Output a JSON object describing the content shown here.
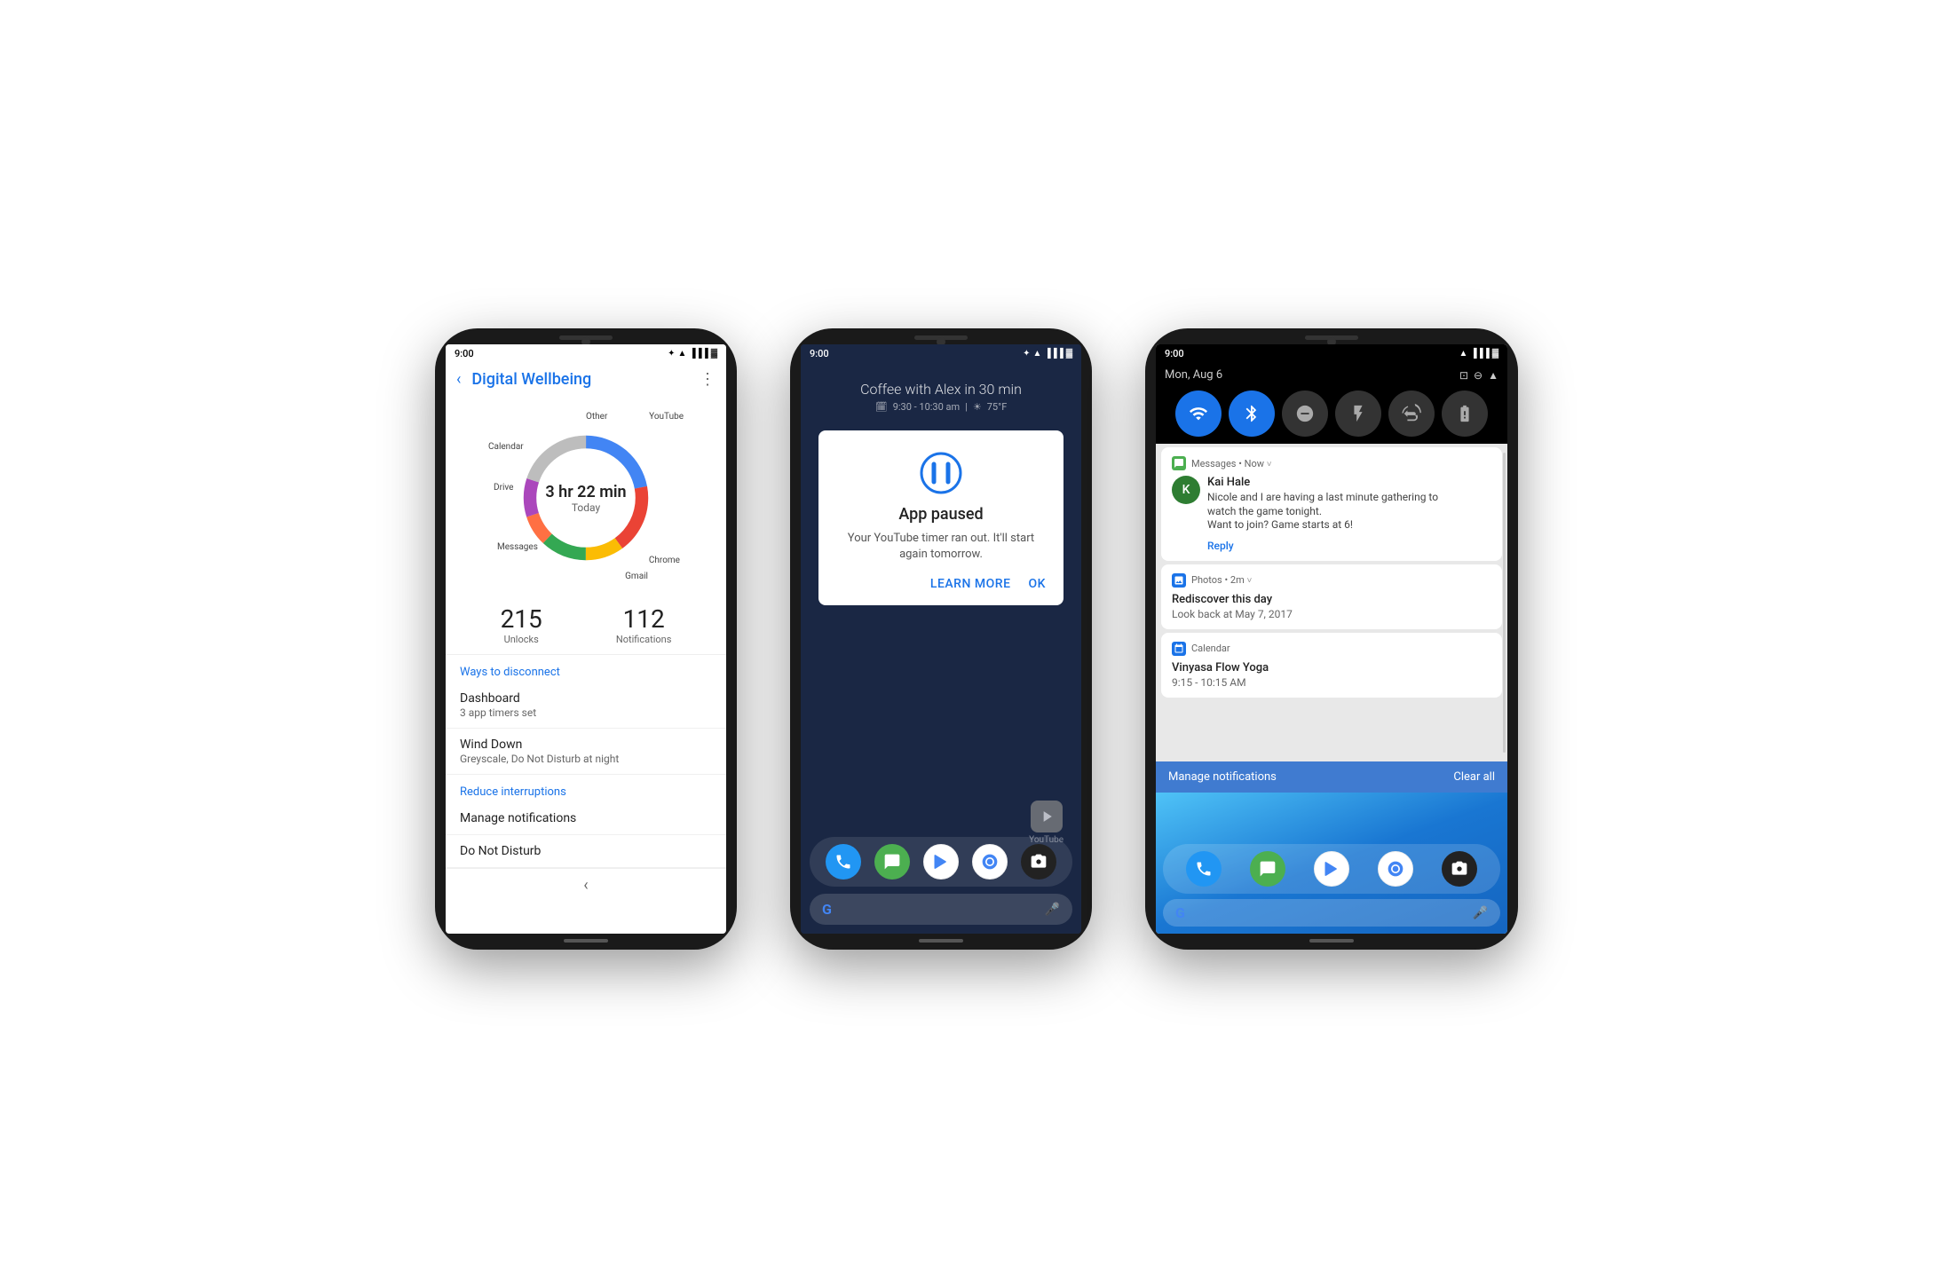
{
  "phone1": {
    "status": {
      "time": "9:00",
      "icons": [
        "bluetooth",
        "wifi",
        "signal",
        "battery"
      ]
    },
    "header": {
      "back_label": "‹",
      "title": "Digital Wellbeing",
      "menu_label": "⋮"
    },
    "donut": {
      "time_label": "3 hr 22 min",
      "today_label": "Today",
      "segments": [
        {
          "label": "YouTube",
          "color": "#4285f4",
          "percentage": 22
        },
        {
          "label": "Chrome",
          "color": "#ea4335",
          "percentage": 18
        },
        {
          "label": "Gmail",
          "color": "#fbbc04",
          "percentage": 10
        },
        {
          "label": "Messages",
          "color": "#34a853",
          "percentage": 12
        },
        {
          "label": "Drive",
          "color": "#ff7043",
          "percentage": 8
        },
        {
          "label": "Calendar",
          "color": "#ab47bc",
          "percentage": 10
        },
        {
          "label": "Other",
          "color": "#bdbdbd",
          "percentage": 20
        }
      ]
    },
    "stats": {
      "unlocks_num": "215",
      "unlocks_label": "Unlocks",
      "notifications_num": "112",
      "notifications_label": "Notifications"
    },
    "section1": {
      "title": "Ways to disconnect",
      "items": [
        {
          "label": "Dashboard",
          "sublabel": "3 app timers set"
        },
        {
          "label": "Wind Down",
          "sublabel": "Greyscale, Do Not Disturb at night"
        }
      ]
    },
    "section2": {
      "title": "Reduce interruptions",
      "items": [
        {
          "label": "Manage notifications",
          "sublabel": ""
        },
        {
          "label": "Do Not Disturb",
          "sublabel": ""
        }
      ]
    }
  },
  "phone2": {
    "status": {
      "time": "9:00",
      "icons": [
        "bluetooth",
        "wifi",
        "signal",
        "battery"
      ]
    },
    "calendar_widget": {
      "title": "Coffee with Alex in 30 min",
      "time": "9:30 - 10:30 am",
      "separator": "|",
      "weather": "75°F"
    },
    "dialog": {
      "title": "App paused",
      "body": "Your YouTube timer ran out. It'll start again tomorrow.",
      "learn_more": "Learn more",
      "ok": "OK"
    },
    "youtube_label": "YouTube",
    "dock": {
      "icons": [
        "phone",
        "message",
        "play_store",
        "chrome",
        "camera"
      ]
    },
    "search": {
      "google_label": "G",
      "mic_label": "🎤"
    }
  },
  "phone3": {
    "status": {
      "time": "9:00",
      "icons": [
        "wifi",
        "signal",
        "battery"
      ]
    },
    "date_row": {
      "date": "Mon, Aug 6",
      "icons": [
        "cast",
        "dnd",
        "wifi"
      ]
    },
    "quick_settings": {
      "tiles": [
        {
          "icon": "wifi",
          "active": true
        },
        {
          "icon": "bluetooth",
          "active": true
        },
        {
          "icon": "dnd",
          "active": false
        },
        {
          "icon": "flashlight",
          "active": false
        },
        {
          "icon": "auto_rotate",
          "active": false
        },
        {
          "icon": "battery_saver",
          "active": false
        }
      ]
    },
    "notifications": [
      {
        "app": "Messages",
        "app_time": "Now",
        "has_dropdown": true,
        "avatar_letter": "K",
        "avatar_color": "#2e7d32",
        "sender": "Kai Hale",
        "message_line1": "Nicole and I are having a last minute gathering to",
        "message_line2": "watch the game tonight.",
        "message_line3": "Want to join? Game starts at 6!",
        "action": "Reply"
      },
      {
        "app": "Photos",
        "app_time": "2m",
        "has_dropdown": true,
        "icon_color": "#1a73e8",
        "title": "Rediscover this day",
        "subtitle": "Look back at May 7, 2017"
      },
      {
        "app": "Calendar",
        "app_time": "",
        "icon_color": "#1a73e8",
        "title": "Vinyasa Flow Yoga",
        "subtitle": "9:15 - 10:15 AM"
      }
    ],
    "manage_bar": {
      "manage_label": "Manage notifications",
      "clear_label": "Clear all"
    },
    "homescreen": {
      "dock_icons": [
        "phone",
        "message",
        "play_store",
        "chrome",
        "camera"
      ],
      "search_g": "G",
      "search_mic": "🎤"
    }
  }
}
